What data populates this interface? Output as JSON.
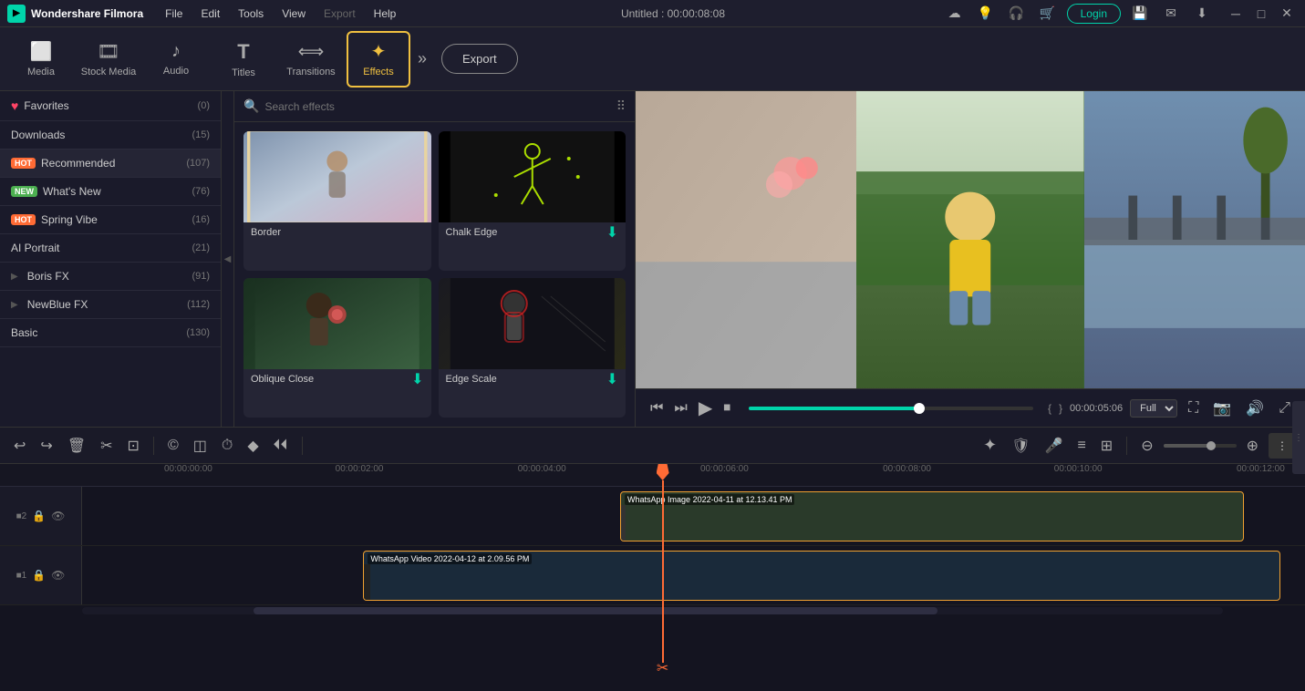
{
  "app": {
    "name": "Wondershare Filmora",
    "title": "Untitled : 00:00:08:08"
  },
  "menu": {
    "items": [
      "File",
      "Edit",
      "Tools",
      "View",
      "Export",
      "Help"
    ]
  },
  "toolbar": {
    "tools": [
      {
        "id": "media",
        "label": "Media",
        "icon": "▣"
      },
      {
        "id": "stock",
        "label": "Stock Media",
        "icon": "🎞"
      },
      {
        "id": "audio",
        "label": "Audio",
        "icon": "♪"
      },
      {
        "id": "titles",
        "label": "Titles",
        "icon": "T"
      },
      {
        "id": "transitions",
        "label": "Transitions",
        "icon": "⟺"
      },
      {
        "id": "effects",
        "label": "Effects",
        "icon": "✦"
      }
    ],
    "export_label": "Export",
    "more_icon": "»"
  },
  "left_panel": {
    "items": [
      {
        "id": "favorites",
        "label": "Favorites",
        "count": "(0)",
        "badge": null,
        "heart": true
      },
      {
        "id": "downloads",
        "label": "Downloads",
        "count": "(15)",
        "badge": null
      },
      {
        "id": "recommended",
        "label": "Recommended",
        "count": "(107)",
        "badge": "HOT"
      },
      {
        "id": "whats_new",
        "label": "What's New",
        "count": "(76)",
        "badge": "NEW"
      },
      {
        "id": "spring_vibe",
        "label": "Spring Vibe",
        "count": "(16)",
        "badge": "HOT"
      },
      {
        "id": "ai_portrait",
        "label": "AI Portrait",
        "count": "(21)",
        "badge": null
      },
      {
        "id": "boris_fx",
        "label": "Boris FX",
        "count": "(91)",
        "badge": null,
        "arrow": true
      },
      {
        "id": "newblue_fx",
        "label": "NewBlue FX",
        "count": "(112)",
        "badge": null,
        "arrow": true
      },
      {
        "id": "basic",
        "label": "Basic",
        "count": "(130)",
        "badge": null
      }
    ]
  },
  "effects_panel": {
    "search_placeholder": "Search effects",
    "effects": [
      {
        "id": "border",
        "label": "Border",
        "has_download": false
      },
      {
        "id": "chalk_edge",
        "label": "Chalk Edge",
        "has_download": true
      },
      {
        "id": "oblique_close",
        "label": "Oblique Close",
        "has_download": true
      },
      {
        "id": "edge_scale",
        "label": "Edge Scale",
        "has_download": true
      }
    ]
  },
  "preview": {
    "time_current": "00:00:05:06",
    "time_start": "{",
    "time_end": "}",
    "quality": "Full"
  },
  "timeline": {
    "tracks": [
      {
        "id": "track2",
        "num": "2",
        "clip_label": "WhatsApp Image 2022-04-11 at 12.13.41 PM"
      },
      {
        "id": "track1",
        "num": "1",
        "clip_label": "WhatsApp Video 2022-04-12 at 2.09.56 PM"
      }
    ],
    "ruler_marks": [
      "00:00:00:00",
      "00:00:02:00",
      "00:00:04:00",
      "00:00:06:00",
      "00:00:08:00",
      "00:00:10:00",
      "00:00:12:00"
    ]
  },
  "header_icons": {
    "cloud": "☁",
    "bulb": "💡",
    "headset": "🎧",
    "cart": "🛒",
    "save": "💾",
    "mail": "✉",
    "download": "⬇"
  }
}
